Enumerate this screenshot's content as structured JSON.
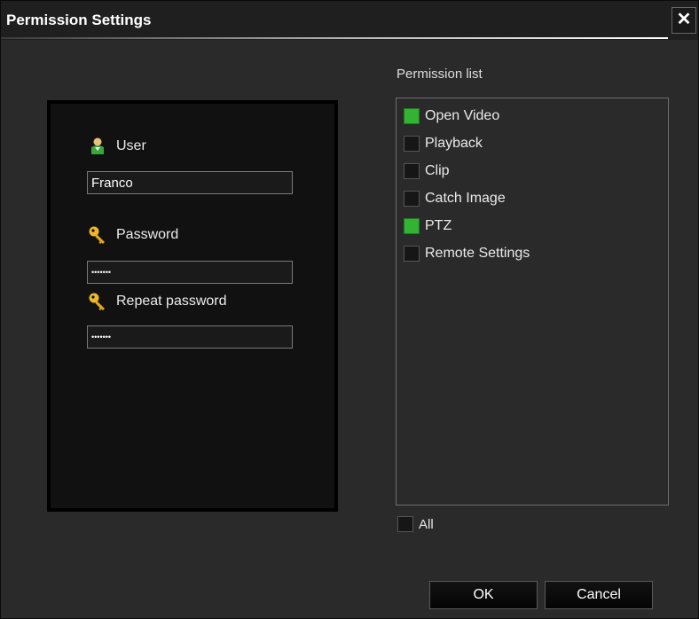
{
  "window": {
    "title": "Permission Settings",
    "close_symbol": "✕"
  },
  "user_form": {
    "user_label": "User",
    "user_value": "Franco",
    "password_label": "Password",
    "password_value": "•••••••",
    "repeat_label": "Repeat password",
    "repeat_value": "•••••••"
  },
  "permissions": {
    "title": "Permission list",
    "items": [
      {
        "label": "Open Video",
        "checked": true
      },
      {
        "label": "Playback",
        "checked": false
      },
      {
        "label": "Clip",
        "checked": false
      },
      {
        "label": "Catch Image",
        "checked": false
      },
      {
        "label": "PTZ",
        "checked": true
      },
      {
        "label": "Remote Settings",
        "checked": false
      }
    ],
    "all_label": "All",
    "all_checked": false
  },
  "buttons": {
    "ok": "OK",
    "cancel": "Cancel"
  },
  "colors": {
    "checked": "#33b233",
    "unchecked": "#161616",
    "background": "#2a2a2a"
  },
  "icons": {
    "user": "user-icon",
    "password": "key-icon",
    "repeat": "key-icon"
  }
}
